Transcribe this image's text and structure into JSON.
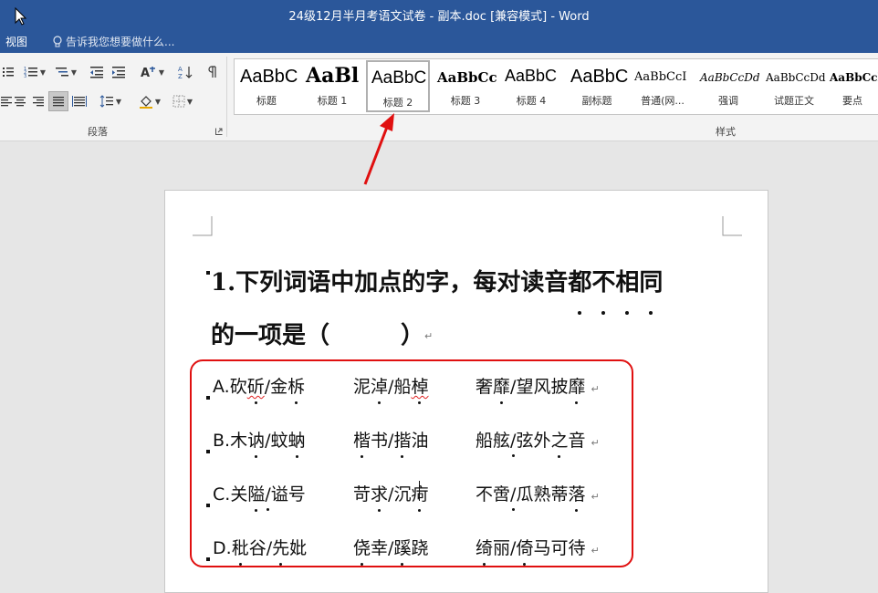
{
  "window": {
    "title": "24级12月半月考语文试卷 - 副本.doc [兼容模式] - Word"
  },
  "tabs": {
    "view": "视图",
    "tell_me": "告诉我您想要做什么..."
  },
  "ribbon": {
    "paragraph_group_label": "段落",
    "styles_group_label": "样式",
    "styles": [
      {
        "sample": "AaBbC",
        "name": "标题",
        "selected": false
      },
      {
        "sample": "AaBl",
        "name": "标题 1",
        "selected": false
      },
      {
        "sample": "AaBbC",
        "name": "标题 2",
        "selected": true
      },
      {
        "sample": "AaBbCc",
        "name": "标题 3",
        "selected": false
      },
      {
        "sample": "AaBbC",
        "name": "标题 4",
        "selected": false
      },
      {
        "sample": "AaBbC",
        "name": "副标题",
        "selected": false
      },
      {
        "sample": "AaBbCcI",
        "name": "普通(网...",
        "selected": false
      },
      {
        "sample": "AaBbCcDd",
        "name": "强调",
        "selected": false
      },
      {
        "sample": "AaBbCcDd",
        "name": "试题正文",
        "selected": false
      },
      {
        "sample": "AaBbCcl",
        "name": "要点",
        "selected": false
      }
    ]
  },
  "document": {
    "question_line1": "1.下列词语中加点的字，每对读音都不相同",
    "question_line2": "的一项是（　　　）",
    "options": [
      [
        "A.砍斫/金柝",
        "泥淖/船棹",
        "奢靡/望风披靡"
      ],
      [
        "B.木讷/蚊蚋",
        "楷书/揩油",
        "船舷/弦外之音"
      ],
      [
        "C.关隘/谥号",
        "苛求/沉疴",
        "不啻/瓜熟蒂落"
      ],
      [
        "D.秕谷/先妣",
        "侥幸/蹊跷",
        "绮丽/倚马可待"
      ]
    ]
  },
  "colors": {
    "title_bar": "#2b579a",
    "annotation": "#e01010"
  },
  "icons": [
    "cursor-icon",
    "lightbulb-icon",
    "bullets-icon",
    "numbering-icon",
    "multilevel-list-icon",
    "decrease-indent-icon",
    "increase-indent-icon",
    "chinese-layout-icon",
    "sort-icon",
    "show-marks-icon",
    "align-left-icon",
    "center-icon",
    "align-right-icon",
    "justify-icon",
    "distributed-icon",
    "line-spacing-icon",
    "shading-icon",
    "borders-icon",
    "dialog-launcher-icon",
    "red-arrow-icon"
  ]
}
